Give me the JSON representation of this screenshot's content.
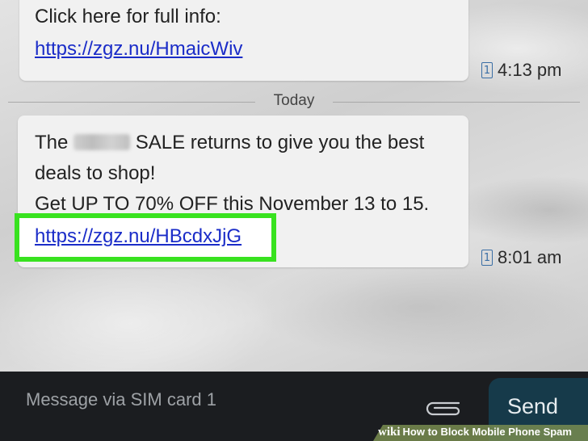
{
  "messages": [
    {
      "lines": [
        "Click here for full info:"
      ],
      "link": "https://zgz.nu/HmaicWiv",
      "time": "4:13 pm"
    },
    {
      "line1_before": "The",
      "line1_after": "SALE returns to give you the best",
      "line2": "deals to shop!",
      "line3": "Get UP TO 70% OFF this November 13 to 15.",
      "link": "https://zgz.nu/HBcdxJjG",
      "time": "8:01 am"
    }
  ],
  "date_divider": "Today",
  "composer": {
    "placeholder": "Message via SIM card 1",
    "send_label": "Send"
  },
  "watermark": {
    "brand": "wiki",
    "text": "How to Block Mobile Phone Spam"
  },
  "colors": {
    "link": "#1a2cc8",
    "highlight": "#38e21f",
    "send_button": "#163a4a",
    "bottom_bar": "#1b1d20"
  },
  "icons": {
    "message_type": "sms-doc-icon",
    "attachment": "paperclip-icon"
  }
}
